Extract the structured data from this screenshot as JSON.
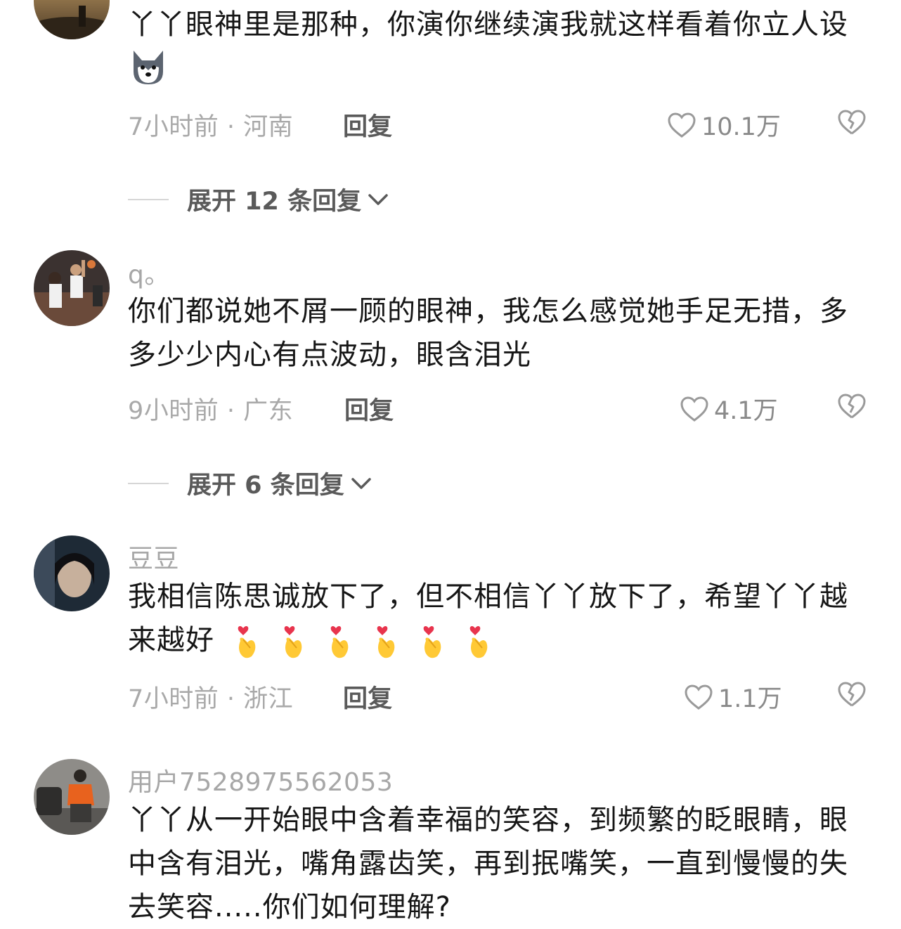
{
  "comments": [
    {
      "username": "",
      "text": "丫丫眼神里是那种，你演你继续演我就这样看着你立人设",
      "time_location": "7小时前 · 河南",
      "reply_label": "回复",
      "likes": "10.1万",
      "expand_label": "展开 12 条回复"
    },
    {
      "username": "q。",
      "text": "你们都说她不屑一顾的眼神，我怎么感觉她手足无措，多多少少内心有点波动，眼含泪光",
      "time_location": "9小时前 · 广东",
      "reply_label": "回复",
      "likes": "4.1万",
      "expand_label": "展开 6 条回复"
    },
    {
      "username": "豆豆",
      "text": "我相信陈思诚放下了，但不相信丫丫放下了，希望丫丫越来越好",
      "time_location": "7小时前 · 浙江",
      "reply_label": "回复",
      "likes": "1.1万"
    },
    {
      "username": "用户7528975562053",
      "text": "丫丫从一开始眼中含着幸福的笑容，到频繁的眨眼睛，眼中含有泪光，嘴角露齿笑，再到抿嘴笑，一直到慢慢的失去笑容.....你们如何理解?"
    }
  ],
  "icons": {
    "like": "heart-outline-icon",
    "dislike": "broken-heart-icon",
    "expand": "chevron-down-icon",
    "emoji_dog": "husky-dog-emoji",
    "emoji_heart_hand": "finger-heart-emoji"
  },
  "colors": {
    "text": "#161616",
    "meta": "#a9a9a9",
    "reply": "#5a5a5a"
  }
}
